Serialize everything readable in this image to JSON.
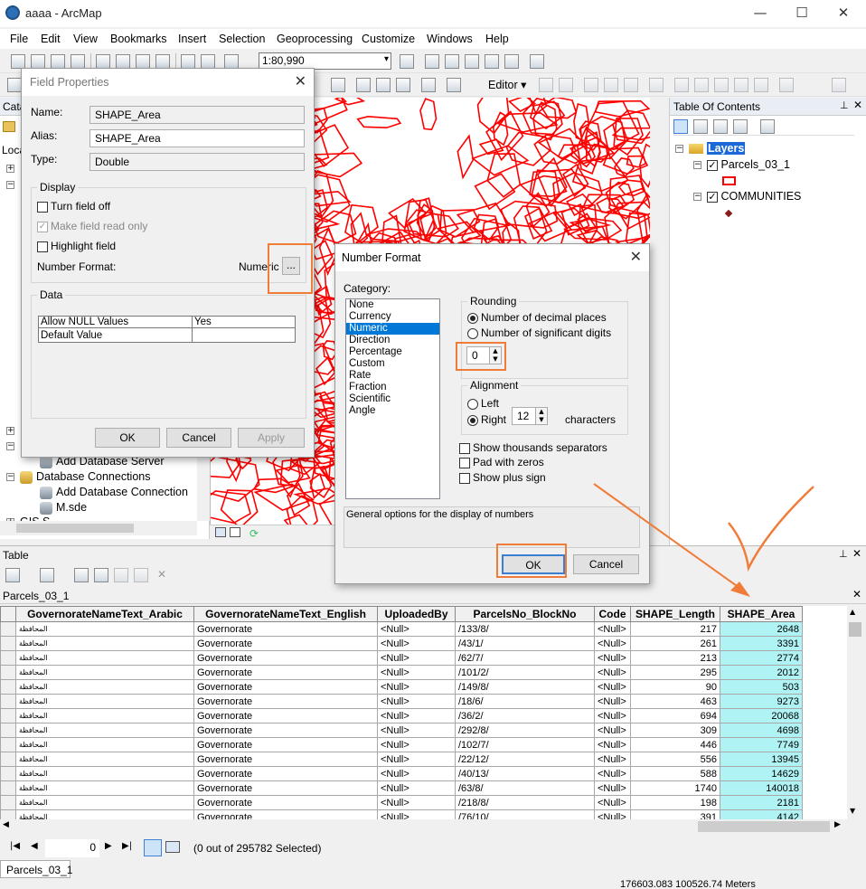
{
  "window": {
    "title": "aaaa - ArcMap",
    "minimize": "—",
    "maximize": "☐",
    "close": "✕"
  },
  "menu": [
    "File",
    "Edit",
    "View",
    "Bookmarks",
    "Insert",
    "Selection",
    "Geoprocessing",
    "Customize",
    "Windows",
    "Help"
  ],
  "toolbar": {
    "scale": "1:80,990",
    "editor": "Editor ▾"
  },
  "catalog": {
    "title": "Cata",
    "location": "Loca",
    "items": [
      {
        "label": "Add Database Server"
      },
      {
        "label": "Database Connections"
      },
      {
        "label": "Add Database Connection"
      },
      {
        "label": "M.sde"
      },
      {
        "label": "GIS S"
      }
    ]
  },
  "toc": {
    "title": "Table Of Contents",
    "root": "Layers",
    "layers": [
      {
        "name": "Parcels_03_1",
        "checked": true
      },
      {
        "name": "COMMUNITIES",
        "checked": true
      }
    ]
  },
  "field_properties": {
    "title": "Field Properties",
    "name_label": "Name:",
    "name_value": "SHAPE_Area",
    "alias_label": "Alias:",
    "alias_value": "SHAPE_Area",
    "type_label": "Type:",
    "type_value": "Double",
    "display_group": "Display",
    "turn_off": "Turn field off",
    "read_only": "Make field read only",
    "highlight": "Highlight field",
    "number_format_label": "Number Format:",
    "number_format_value": "Numeric",
    "ellipsis": "...",
    "data_group": "Data",
    "data_rows": [
      {
        "k": "Allow NULL Values",
        "v": "Yes"
      },
      {
        "k": "Default Value",
        "v": ""
      }
    ],
    "ok": "OK",
    "cancel": "Cancel",
    "apply": "Apply"
  },
  "number_format": {
    "title": "Number Format",
    "category_label": "Category:",
    "categories": [
      "None",
      "Currency",
      "Numeric",
      "Direction",
      "Percentage",
      "Custom",
      "Rate",
      "Fraction",
      "Scientific",
      "Angle"
    ],
    "selected_category": "Numeric",
    "rounding_group": "Rounding",
    "decimal_places": "Number of decimal places",
    "significant_digits": "Number of significant digits",
    "rounding_value": "0",
    "alignment_group": "Alignment",
    "left": "Left",
    "right": "Right",
    "align_value": "12",
    "characters": "characters",
    "thousands": "Show thousands separators",
    "pad_zeros": "Pad with zeros",
    "plus_sign": "Show plus sign",
    "description": "General options for the display of numbers",
    "ok": "OK",
    "cancel": "Cancel"
  },
  "table": {
    "window_title": "Table",
    "layer_tab": "Parcels_03_1",
    "columns": [
      "GovernorateNameText_Arabic",
      "GovernorateNameText_English",
      "UploadedBy",
      "ParcelsNo_BlockNo",
      "Code",
      "SHAPE_Length",
      "SHAPE_Area"
    ],
    "rows": [
      [
        "المحافظة",
        "Governorate",
        "<Null>",
        "/133/8/",
        "<Null>",
        "217",
        "2648"
      ],
      [
        "المحافظة",
        "Governorate",
        "<Null>",
        "/43/1/",
        "<Null>",
        "261",
        "3391"
      ],
      [
        "المحافظة",
        "Governorate",
        "<Null>",
        "/62/7/",
        "<Null>",
        "213",
        "2774"
      ],
      [
        "المحافظة",
        "Governorate",
        "<Null>",
        "/101/2/",
        "<Null>",
        "295",
        "2012"
      ],
      [
        "المحافظة",
        "Governorate",
        "<Null>",
        "/149/8/",
        "<Null>",
        "90",
        "503"
      ],
      [
        "المحافظة",
        "Governorate",
        "<Null>",
        "/18/6/",
        "<Null>",
        "463",
        "9273"
      ],
      [
        "المحافظة",
        "Governorate",
        "<Null>",
        "/36/2/",
        "<Null>",
        "694",
        "20068"
      ],
      [
        "المحافظة",
        "Governorate",
        "<Null>",
        "/292/8/",
        "<Null>",
        "309",
        "4698"
      ],
      [
        "المحافظة",
        "Governorate",
        "<Null>",
        "/102/7/",
        "<Null>",
        "446",
        "7749"
      ],
      [
        "المحافظة",
        "Governorate",
        "<Null>",
        "/22/12/",
        "<Null>",
        "556",
        "13945"
      ],
      [
        "المحافظة",
        "Governorate",
        "<Null>",
        "/40/13/",
        "<Null>",
        "588",
        "14629"
      ],
      [
        "المحافظة",
        "Governorate",
        "<Null>",
        "/63/8/",
        "<Null>",
        "1740",
        "140018"
      ],
      [
        "المحافظة",
        "Governorate",
        "<Null>",
        "/218/8/",
        "<Null>",
        "198",
        "2181"
      ],
      [
        "المحافظة",
        "Governorate",
        "<Null>",
        "/76/10/",
        "<Null>",
        "391",
        "4142"
      ]
    ],
    "record_index": "0",
    "selection_status": "(0 out of 295782 Selected)",
    "bottom_tab": "Parcels_03_1"
  },
  "status": {
    "coords": "176603.083 100526.74 Meters"
  },
  "colors": {
    "map_lines": "#ff0000",
    "highlight": "#f07c3a",
    "area_column": "#aff3f5",
    "selection": "#0078d7"
  }
}
